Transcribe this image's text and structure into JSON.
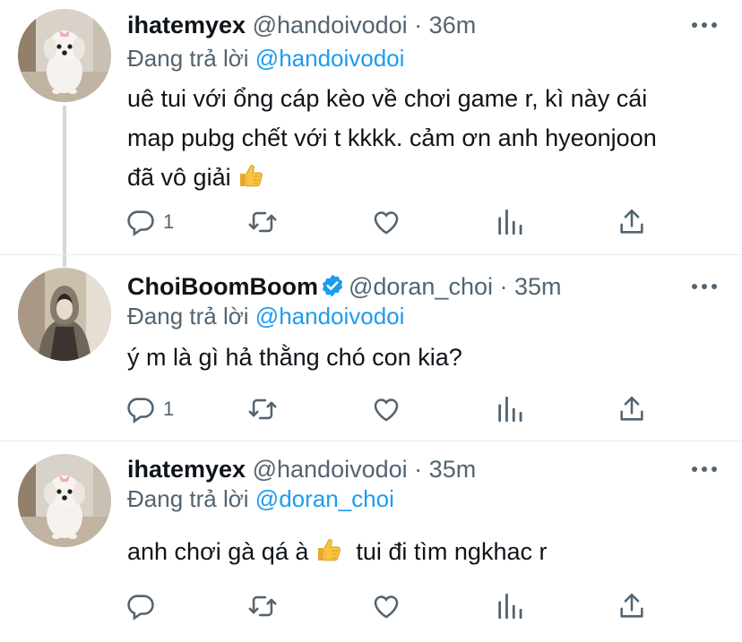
{
  "tweets": [
    {
      "name": "ihatemyex",
      "handle": "@handoivodoi",
      "dot": "·",
      "time": "36m",
      "verified": false,
      "reply_prefix": "Đang trả lời",
      "reply_mention": "@handoivodoi",
      "text_lines": [
        "uê tui với ổng cáp kèo về chơi game r, kì này cái",
        "map pubg chết với t kkkk. cảm ơn anh hyeonjoon",
        "đã vô giải"
      ],
      "reply_count": "1"
    },
    {
      "name": "ChoiBoomBoom",
      "handle": "@doran_choi",
      "dot": "·",
      "time": "35m",
      "verified": true,
      "reply_prefix": "Đang trả lời",
      "reply_mention": "@handoivodoi",
      "text_lines": [
        "ý m là gì hả thằng chó con kia?"
      ],
      "reply_count": "1"
    },
    {
      "name": "ihatemyex",
      "handle": "@handoivodoi",
      "dot": "·",
      "time": "35m",
      "verified": false,
      "reply_prefix": "Đang trả lời",
      "reply_mention": "@doran_choi",
      "text_before": "anh chơi gà qá à",
      "text_after": "tui đi tìm ngkhac r",
      "reply_count": ""
    }
  ],
  "colors": {
    "accent": "#1d9bf0",
    "muted": "#536471",
    "text": "#0f1419",
    "thread_line": "#cfd9de"
  },
  "icons": [
    "reply-icon",
    "retweet-icon",
    "like-icon",
    "views-icon",
    "share-icon",
    "more-icon",
    "verified-badge-icon",
    "thumbs-up-emoji"
  ]
}
